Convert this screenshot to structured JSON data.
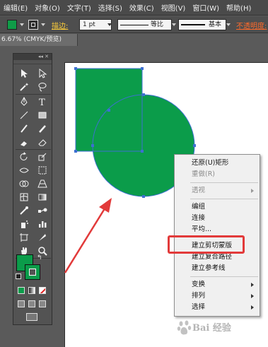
{
  "menubar": {
    "items": [
      "编辑(E)",
      "对象(O)",
      "文字(T)",
      "选择(S)",
      "效果(C)",
      "视图(V)",
      "窗口(W)",
      "帮助(H)"
    ]
  },
  "control_bar": {
    "fill_color": "#109c48",
    "stroke_color": "#ffffff",
    "stroke_label": "描边:",
    "stroke_weight": "1 pt",
    "profile_label": "等比",
    "brush_label": "基本",
    "opacity_label": "不透明度:"
  },
  "document": {
    "tab_title": "6.67% (CMYK/预览)"
  },
  "artwork": {
    "rect_color": "#0b9c4a",
    "circle_color": "#0b9c4a",
    "selection_color": "#3d6fd1"
  },
  "context_menu": {
    "undo": "还原(U)矩形",
    "redo": "重做(R)",
    "perspective": "透视",
    "group": "编组",
    "join": "连接",
    "average": "平均...",
    "make_clipping_mask": "建立剪切蒙版",
    "make_compound_path": "建立复合路径",
    "make_guides": "建立参考线",
    "transform": "变换",
    "arrange": "排列",
    "select": "选择"
  },
  "annotation": {
    "color": "#e23a3a"
  },
  "watermark": {
    "text": "Bai 经验"
  }
}
